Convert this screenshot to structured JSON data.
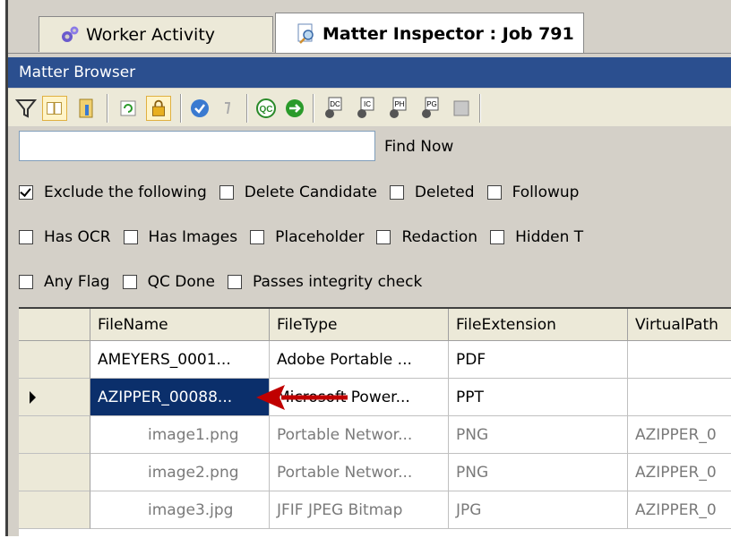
{
  "tabs": [
    {
      "label": "Worker Activity",
      "icon": "gears-icon"
    },
    {
      "label": "Matter Inspector : Job 791",
      "icon": "magnifier-icon",
      "active": true
    }
  ],
  "panel_title": "Matter Browser",
  "toolbar_icons": [
    "filter-icon",
    "book-icon",
    "columns-icon",
    "refresh-icon",
    "lock-icon",
    "check-icon",
    "undo-icon",
    "qc-icon",
    "go-arrow-icon",
    "dc-icon",
    "ic-icon",
    "ph-icon",
    "pg-icon",
    "stop-icon"
  ],
  "find": {
    "value": "",
    "button": "Find Now"
  },
  "filters": {
    "row1": [
      {
        "label": "Exclude the following",
        "checked": true
      },
      {
        "label": "Delete Candidate",
        "checked": false
      },
      {
        "label": "Deleted",
        "checked": false
      },
      {
        "label": "Followup",
        "checked": false
      }
    ],
    "row2": [
      {
        "label": "Has OCR",
        "checked": false
      },
      {
        "label": "Has Images",
        "checked": false
      },
      {
        "label": "Placeholder",
        "checked": false
      },
      {
        "label": "Redaction",
        "checked": false
      },
      {
        "label": "Hidden T",
        "checked": false
      }
    ],
    "row3": [
      {
        "label": "Any Flag",
        "checked": false
      },
      {
        "label": "QC Done",
        "checked": false
      },
      {
        "label": "Passes integrity check",
        "checked": false
      }
    ]
  },
  "grid": {
    "columns": [
      "FileName",
      "FileType",
      "FileExtension",
      "VirtualPath"
    ],
    "rows": [
      {
        "cells": [
          "AMEYERS_0001...",
          "Adobe Portable ...",
          "PDF",
          ""
        ],
        "selected": false,
        "child": false
      },
      {
        "cells": [
          "AZIPPER_00088...",
          "Microsoft Power...",
          "PPT",
          ""
        ],
        "selected": true,
        "child": false
      },
      {
        "cells": [
          "image1.png",
          "Portable Networ...",
          "PNG",
          "AZIPPER_0"
        ],
        "selected": false,
        "child": true
      },
      {
        "cells": [
          "image2.png",
          "Portable Networ...",
          "PNG",
          "AZIPPER_0"
        ],
        "selected": false,
        "child": true
      },
      {
        "cells": [
          "image3.jpg",
          "JFIF JPEG Bitmap",
          "JPG",
          "AZIPPER_0"
        ],
        "selected": false,
        "child": true
      }
    ]
  },
  "colors": {
    "titlebar": "#2b4f8f",
    "selected_row": "#0b2f6b",
    "annotation_arrow": "#c00000"
  }
}
